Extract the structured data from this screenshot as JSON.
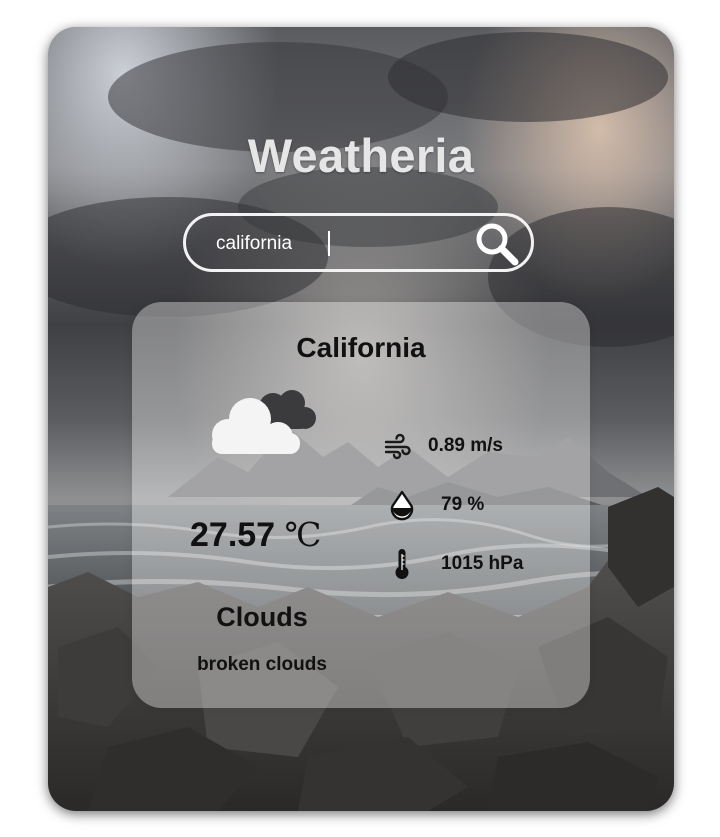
{
  "app": {
    "title": "Weatheria"
  },
  "search": {
    "value": "california",
    "icon": "search-icon"
  },
  "weather": {
    "city": "California",
    "icon": "broken-clouds-icon",
    "temperature": "27.57",
    "temperature_unit": "℃",
    "condition": "Clouds",
    "description": "broken clouds",
    "wind": {
      "icon": "wind-icon",
      "value": "0.89 m/s"
    },
    "humidity": {
      "icon": "droplet-icon",
      "value": "79 %"
    },
    "pressure": {
      "icon": "thermometer-icon",
      "value": "1015 hPa"
    }
  },
  "colors": {
    "title_text": "#e6e6e6",
    "search_border": "#f2f2f2",
    "card_overlay": "rgba(255,255,255,0.36)",
    "text_dark": "#111111"
  }
}
